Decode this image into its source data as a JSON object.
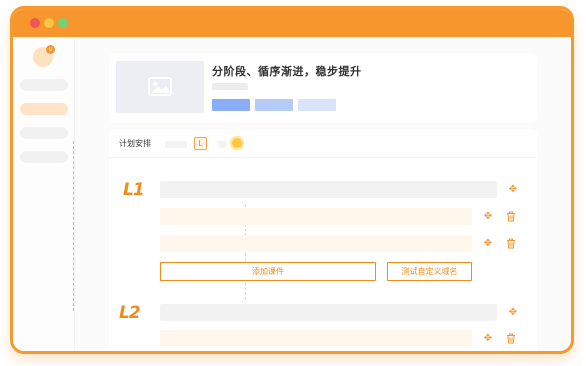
{
  "window": {
    "traffic_lights": [
      "#f25555",
      "#f7c744",
      "#6fd37a"
    ],
    "accent": "#f7962c"
  },
  "sidebar": {
    "avatar_badge": "v",
    "items": [
      {
        "name": "nav-1",
        "active": false
      },
      {
        "name": "nav-2",
        "active": true
      },
      {
        "name": "nav-3",
        "active": false
      },
      {
        "name": "nav-4",
        "active": false
      }
    ]
  },
  "course": {
    "title": "分阶段、循序渐进，稳步提升",
    "tag_colors": [
      "#8aaef5",
      "#b6cbf8",
      "#d9e4fb"
    ]
  },
  "plan": {
    "label": "计划安排",
    "level_badge": "L"
  },
  "levels": [
    {
      "label": "L1"
    },
    {
      "label": "L2"
    }
  ],
  "actions": {
    "add_course": "添加课件",
    "test_domain": "测试自定义域名"
  },
  "icons": {
    "move": "move-icon",
    "delete": "trash-icon",
    "image": "image-icon"
  }
}
